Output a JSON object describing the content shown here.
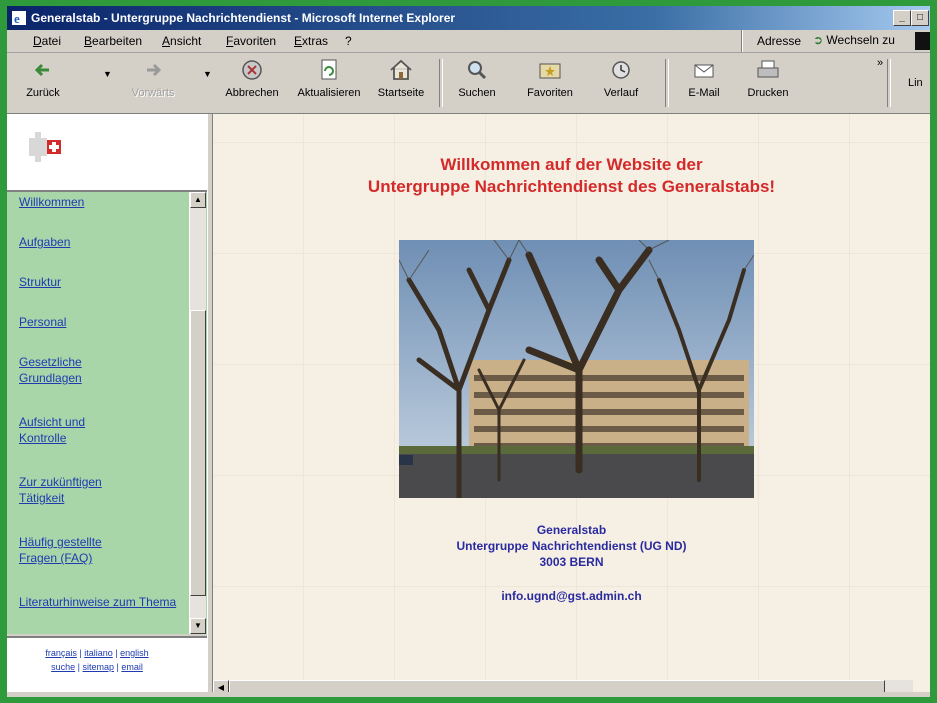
{
  "window": {
    "title": "Generalstab - Untergruppe Nachrichtendienst - Microsoft Internet Explorer"
  },
  "menu": [
    "Datei",
    "Bearbeiten",
    "Ansicht",
    "Favoriten",
    "Extras",
    "?"
  ],
  "address": {
    "label": "Adresse",
    "go_label": "Wechseln zu"
  },
  "toolbar": {
    "back": "Zurück",
    "forward": "Vorwärts",
    "stop": "Abbrechen",
    "refresh": "Aktualisieren",
    "home": "Startseite",
    "search": "Suchen",
    "favorites": "Favoriten",
    "history": "Verlauf",
    "mail": "E-Mail",
    "print": "Drucken",
    "links": "Lin"
  },
  "nav": {
    "items": [
      "Willkommen",
      "Aufgaben",
      "Struktur",
      "Personal",
      "Gesetzliche Grundlagen",
      "Aufsicht und Kontrolle",
      "Zur zukünftigen Tätigkeit",
      "Häufig gestellte Fragen (FAQ)",
      "Literaturhinweise zum Thema"
    ]
  },
  "languages": {
    "francais": "français",
    "italiano": "italiano",
    "english": "english",
    "suche": "suche",
    "sitemap": "sitemap",
    "email": "email"
  },
  "main": {
    "welcome_line1": "Willkommen auf der Website der",
    "welcome_line2": "Untergruppe Nachrichtendienst des Generalstabs!",
    "org": "Generalstab",
    "unit": "Untergruppe Nachrichtendienst (UG ND)",
    "city": "3003 BERN",
    "email": "info.ugnd@gst.admin.ch"
  },
  "colors": {
    "frame_border": "#2f9a3c",
    "nav_background": "#a8d6a8",
    "welcome_red": "#d42a2a",
    "contact_blue": "#2a2aa0",
    "link_blue": "#1e3bb0"
  }
}
